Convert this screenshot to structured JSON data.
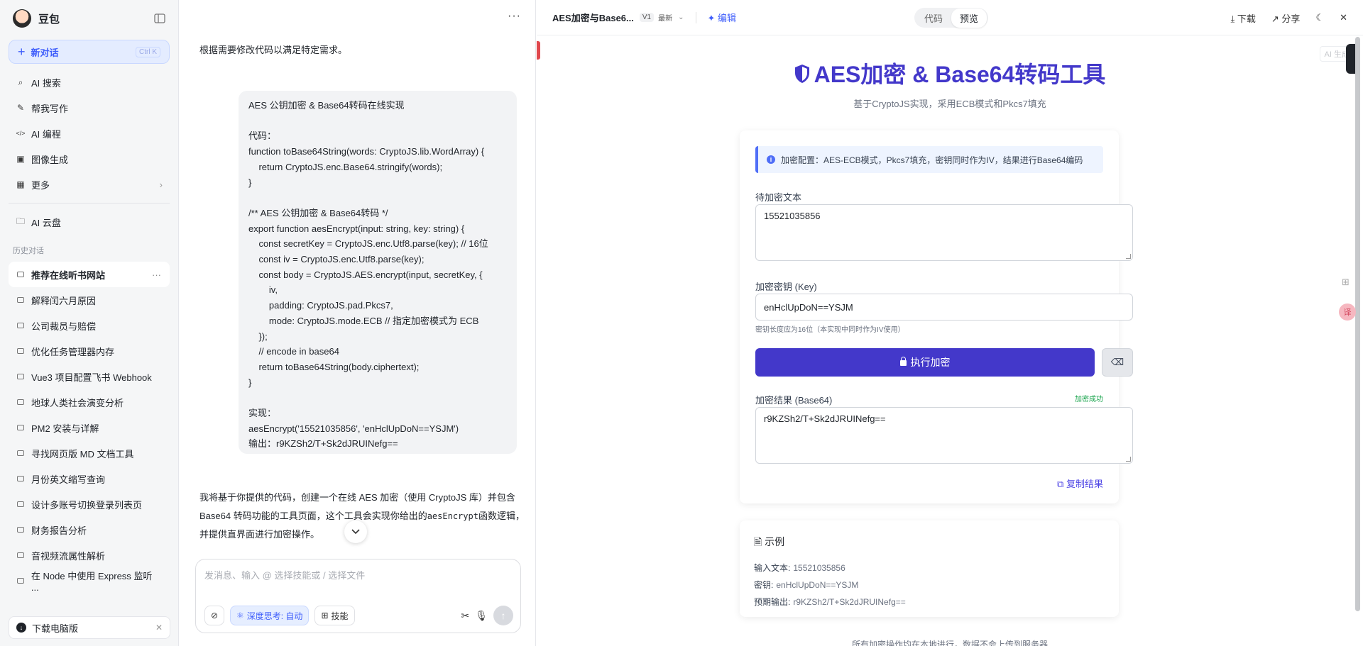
{
  "sidebar": {
    "brand": "豆包",
    "new_chat": "新对话",
    "new_chat_kbd": "Ctrl K",
    "nav": [
      {
        "icon": "search-icon",
        "glyph": "⌕",
        "label": "AI 搜索"
      },
      {
        "icon": "pen-icon",
        "glyph": "✎",
        "label": "帮我写作"
      },
      {
        "icon": "code-icon",
        "glyph": "</>",
        "label": "AI 编程"
      },
      {
        "icon": "image-icon",
        "glyph": "▣",
        "label": "图像生成"
      },
      {
        "icon": "grid-icon",
        "glyph": "▦",
        "label": "更多"
      }
    ],
    "cloud": "AI 云盘",
    "history_title": "历史对话",
    "history": [
      "推荐在线听书网站",
      "解释闰六月原因",
      "公司裁员与赔偿",
      "优化任务管理器内存",
      "Vue3 项目配置飞书 Webhook",
      "地球人类社会演变分析",
      "PM2 安装与详解",
      "寻找网页版 MD 文档工具",
      "月份英文缩写查询",
      "设计多账号切换登录列表页",
      "财务报告分析",
      "音视频流属性解析",
      "在 Node 中使用 Express 监听 ..."
    ],
    "download": "下载电脑版"
  },
  "chat": {
    "intro": "根据需要修改代码以满足特定需求。",
    "user_message": "AES 公钥加密 & Base64转码在线实现\n\n代码：\nfunction toBase64String(words: CryptoJS.lib.WordArray) {\n    return CryptoJS.enc.Base64.stringify(words);\n}\n\n/** AES 公钥加密 & Base64转码 */\nexport function aesEncrypt(input: string, key: string) {\n    const secretKey = CryptoJS.enc.Utf8.parse(key); // 16位\n    const iv = CryptoJS.enc.Utf8.parse(key);\n    const body = CryptoJS.AES.encrypt(input, secretKey, {\n        iv,\n        padding: CryptoJS.pad.Pkcs7,\n        mode: CryptoJS.mode.ECB // 指定加密模式为 ECB\n    });\n    // encode in base64\n    return toBase64String(body.ciphertext);\n}\n\n实现：\naesEncrypt('15521035856', 'enHclUpDoN==YSJM')\n输出：r9KZSh2/T+Sk2dJRUINefg==",
    "reply_part1": "我将基于你提供的代码，创建一个在线 AES 加密（使用 CryptoJS 库）并包含 Base64 转码功能的工具页面，这个工具会实现你给出的",
    "reply_code": "aesEncrypt",
    "reply_part2": "函数逻辑，并提供直",
    "reply_part3": "界面进行加密操作。",
    "composer_placeholder": "发消息、输入 @ 选择技能或 / 选择文件",
    "deep_think": "深度思考: 自动",
    "skills": "技能"
  },
  "preview": {
    "title": "AES加密与Base6...",
    "version": "V1",
    "latest": "最新",
    "edit": "编辑",
    "tab_code": "代码",
    "tab_preview": "预览",
    "download": "下载",
    "share": "分享",
    "ai_tag": "AI 生成",
    "app": {
      "title": "AES加密 & Base64转码工具",
      "subtitle": "基于CryptoJS实现，采用ECB模式和Pkcs7填充",
      "info": "加密配置：AES-ECB模式，Pkcs7填充，密钥同时作为IV，结果进行Base64编码",
      "plaintext_label": "待加密文本",
      "plaintext_value": "15521035856",
      "key_label": "加密密钥 (Key)",
      "key_value": "enHclUpDoN==YSJM",
      "key_hint": "密钥长度应为16位（本实现中同时作为IV使用）",
      "encrypt_button": "执行加密",
      "result_label": "加密结果 (Base64)",
      "result_status": "加密成功",
      "result_value": "r9KZSh2/T+Sk2dJRUINefg==",
      "copy": "复制结果",
      "example_title": "示例",
      "ex_input_label": "输入文本:",
      "ex_input": "15521035856",
      "ex_key_label": "密钥:",
      "ex_key": "enHclUpDoN==YSJM",
      "ex_output_label": "预期输出:",
      "ex_output": "r9KZSh2/T+Sk2dJRUINefg==",
      "footer": "所有加密操作均在本地进行，数据不会上传到服务器"
    }
  },
  "colors": {
    "accent": "#3f5efb",
    "app_primary": "#4338ca",
    "success": "#16a34a"
  }
}
